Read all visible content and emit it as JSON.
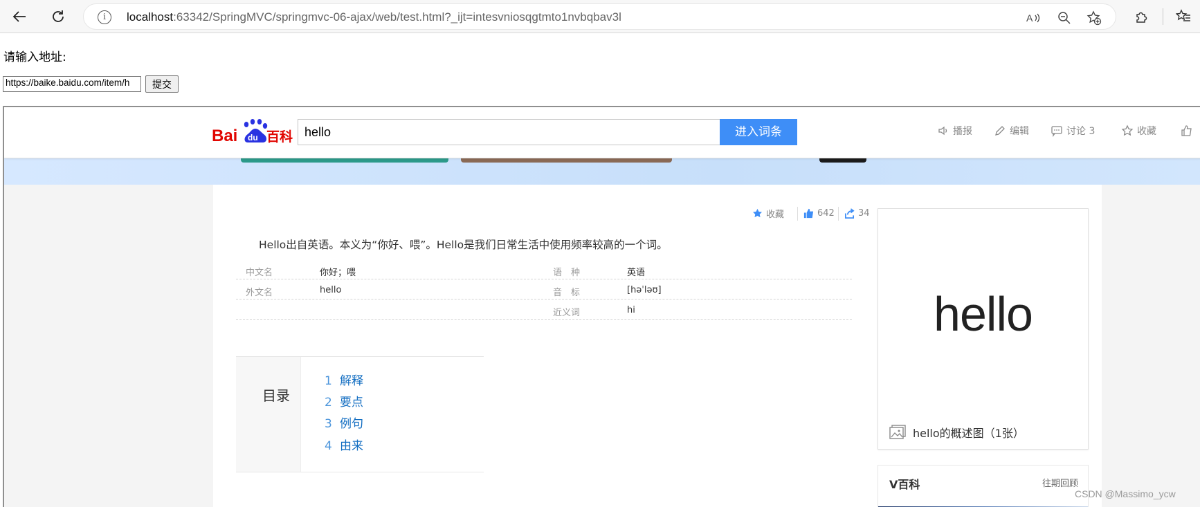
{
  "browser": {
    "url_host": "localhost",
    "url_rest": ":63342/SpringMVC/springmvc-06-ajax/web/test.html?_ijt=intesvniosqgtmto1nvbqbav3l"
  },
  "form": {
    "prompt": "请输入地址:",
    "url_value": "https://baike.baidu.com/item/h",
    "submit_label": "提交"
  },
  "baike": {
    "logo_bai": "Bai",
    "logo_du": "du",
    "logo_baike": "百科",
    "search_value": "hello",
    "search_button": "进入词条",
    "actions": {
      "broadcast": "播报",
      "edit": "编辑",
      "discuss": "讨论 3",
      "collect": "收藏"
    },
    "stats": {
      "collect": "收藏",
      "likes": "642",
      "shares": "34"
    },
    "summary": "Hello出自英语。本义为“你好、喂”。Hello是我们日常生活中使用频率较高的一个词。",
    "info": {
      "left": [
        {
          "label": "中文名",
          "value": "你好；喂"
        },
        {
          "label": "外文名",
          "value": "hello"
        }
      ],
      "right": [
        {
          "label": "语　种",
          "value": "英语"
        },
        {
          "label": "音　标",
          "value": "[həˈləʊ]"
        },
        {
          "label": "近义词",
          "value": "hi"
        }
      ]
    },
    "toc": {
      "title": "目录",
      "items": [
        {
          "num": "1",
          "label": "解释"
        },
        {
          "num": "2",
          "label": "要点"
        },
        {
          "num": "3",
          "label": "例句"
        },
        {
          "num": "4",
          "label": "由来"
        }
      ]
    },
    "side": {
      "image_text": "hello",
      "caption": "hello的概述图（1张）"
    },
    "vbaike": {
      "title": "V百科",
      "more": "往期回顾"
    }
  },
  "watermark": "CSDN @Massimo_ycw",
  "colors": {
    "accent_blue": "#3e8ef7",
    "link_blue": "#136ec2",
    "baidu_red": "#e10601",
    "baidu_blue": "#2932e1"
  }
}
